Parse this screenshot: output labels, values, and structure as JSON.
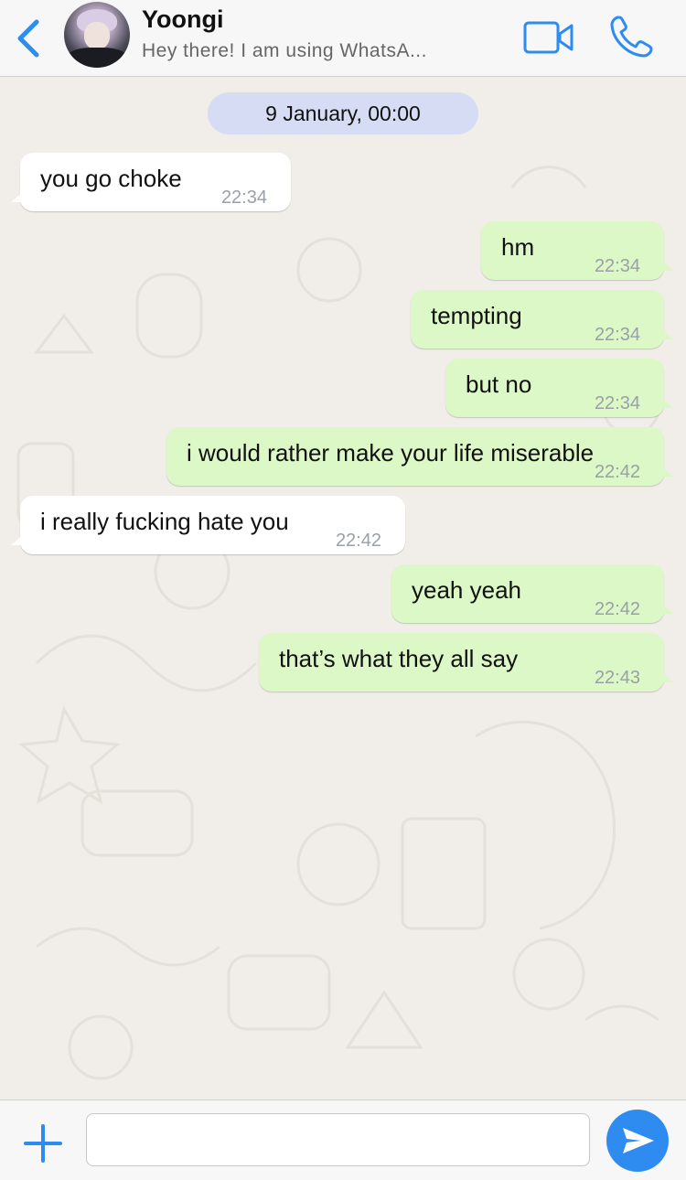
{
  "header": {
    "contact_name": "Yoongi",
    "contact_status": "Hey there! I am using WhatsA...",
    "back_icon": "chevron-left-icon",
    "video_icon": "video-camera-icon",
    "call_icon": "phone-icon",
    "accent_color": "#2e8cf0"
  },
  "chat": {
    "date_label": "9 January, 00:00",
    "messages": [
      {
        "direction": "in",
        "text": "you go choke",
        "time": "22:34"
      },
      {
        "direction": "out",
        "text": "hm",
        "time": "22:34"
      },
      {
        "direction": "out",
        "text": "tempting",
        "time": "22:34"
      },
      {
        "direction": "out",
        "text": "but no",
        "time": "22:34"
      },
      {
        "direction": "out",
        "text": "i would rather make your life miserable",
        "time": "22:42"
      },
      {
        "direction": "in",
        "text": "i really fucking hate you",
        "time": "22:42"
      },
      {
        "direction": "out",
        "text": "yeah yeah",
        "time": "22:42"
      },
      {
        "direction": "out",
        "text": "that’s what they all say",
        "time": "22:43"
      }
    ],
    "incoming_color": "#ffffff",
    "outgoing_color": "#dcf8c6"
  },
  "composer": {
    "input_value": "",
    "plus_icon": "plus-icon",
    "send_icon": "send-icon"
  }
}
